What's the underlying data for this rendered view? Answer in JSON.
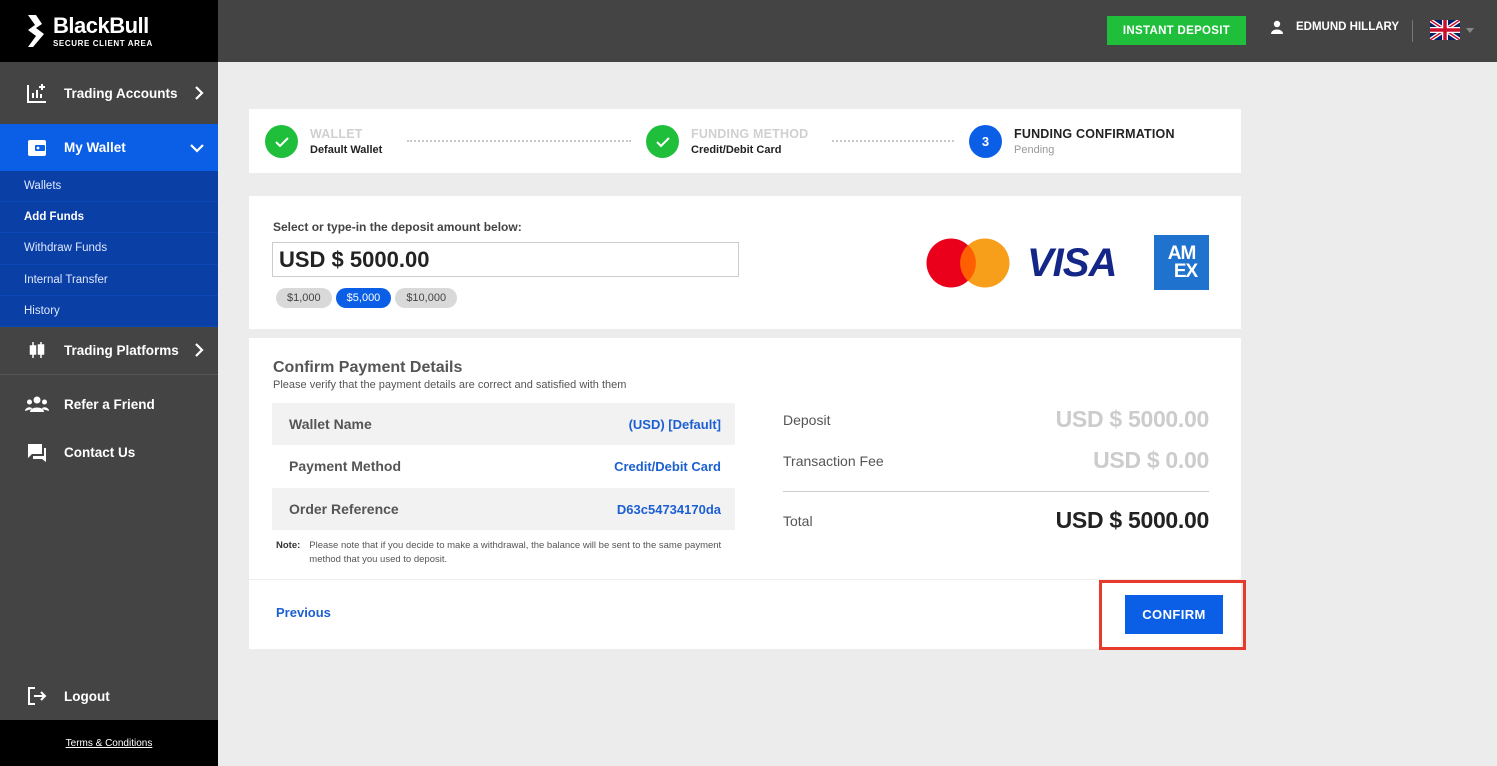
{
  "brand": {
    "name": "BlackBull",
    "subtitle": "SECURE CLIENT AREA"
  },
  "sidebar": {
    "items": [
      {
        "label": "Trading Accounts",
        "icon": "chart-plus-icon"
      },
      {
        "label": "My Wallet",
        "icon": "wallet-icon",
        "active": true
      },
      {
        "label": "Trading Platforms",
        "icon": "candlestick-icon"
      },
      {
        "label": "Refer a Friend",
        "icon": "people-icon"
      },
      {
        "label": "Contact Us",
        "icon": "chat-icon"
      }
    ],
    "wallet_subitems": [
      "Wallets",
      "Add Funds",
      "Withdraw Funds",
      "Internal Transfer",
      "History"
    ],
    "current_subitem": "Add Funds",
    "logout": "Logout",
    "terms": "Terms & Conditions"
  },
  "topbar": {
    "instant_deposit": "INSTANT DEPOSIT",
    "user_name": "EDMUND HILLARY",
    "language_flag": "uk-flag-icon"
  },
  "stepper": {
    "steps": [
      {
        "title": "WALLET",
        "subtitle": "Default Wallet",
        "state": "done"
      },
      {
        "title": "FUNDING METHOD",
        "subtitle": "Credit/Debit Card",
        "state": "done"
      },
      {
        "number": "3",
        "title": "FUNDING CONFIRMATION",
        "subtitle": "Pending",
        "state": "current"
      }
    ]
  },
  "amount": {
    "label": "Select or type-in the deposit amount below:",
    "value": "USD $ 5000.00",
    "presets": [
      "$1,000",
      "$5,000",
      "$10,000"
    ],
    "selected_preset": "$5,000",
    "card_brands": [
      "mastercard",
      "VISA",
      "AMEX"
    ]
  },
  "confirm": {
    "title": "Confirm Payment Details",
    "subtitle": "Please verify that the payment details are correct and satisfied with them",
    "details": [
      {
        "key": "Wallet Name",
        "value": "(USD) [Default]"
      },
      {
        "key": "Payment Method",
        "value": "Credit/Debit Card"
      },
      {
        "key": "Order Reference",
        "value": "D63c54734170da"
      }
    ],
    "note_label": "Note:",
    "note_text": "Please note that if you decide to make a withdrawal, the balance will be sent to the same payment method that you used to deposit.",
    "summary": [
      {
        "key": "Deposit",
        "value": "USD $ 5000.00"
      },
      {
        "key": "Transaction Fee",
        "value": "USD $ 0.00"
      },
      {
        "key": "Total",
        "value": "USD $ 5000.00"
      }
    ],
    "previous": "Previous",
    "confirm_button": "CONFIRM"
  },
  "colors": {
    "accent": "#0b5fe6",
    "success": "#1fbf3c",
    "sidebar_bg": "#444444",
    "highlight": "#e83a2b"
  }
}
